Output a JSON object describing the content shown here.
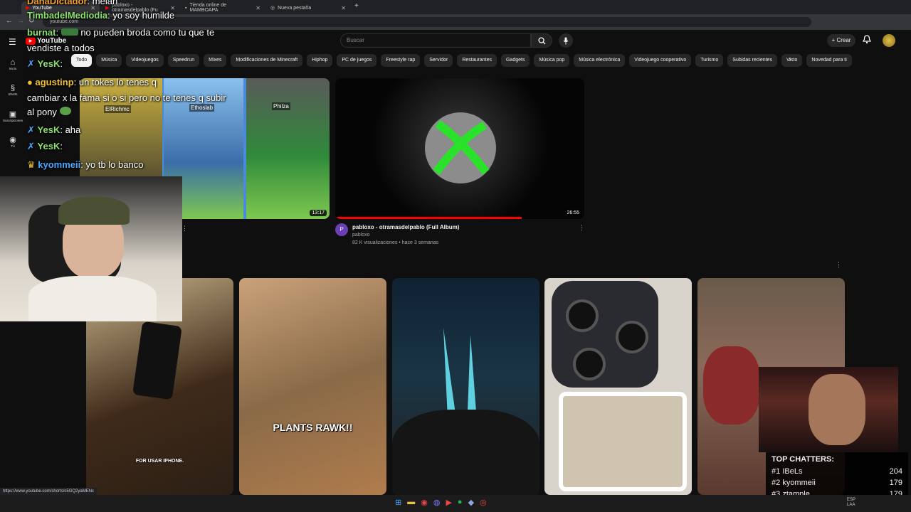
{
  "browser": {
    "tabs": [
      {
        "label": "YouTube",
        "active": true
      },
      {
        "label": "pabloxo - otramasdelpablo (Fu",
        "active": false
      },
      {
        "label": "Tienda online de MAMBOAPA",
        "active": false
      },
      {
        "label": "Nueva pestaña",
        "active": false
      }
    ],
    "url": "youtube.com",
    "status_url": "https://www.youtube.com/shorts/c5GQ2yaMENc"
  },
  "youtube": {
    "logo": "YouTube",
    "search_placeholder": "Buscar",
    "create_label": "Crear",
    "sidebar": [
      {
        "label": "Inicio",
        "icon": "home-icon"
      },
      {
        "label": "Shorts",
        "icon": "shorts-icon"
      },
      {
        "label": "Suscripciones",
        "icon": "subscriptions-icon"
      },
      {
        "label": "Tú",
        "icon": "user-icon"
      }
    ],
    "chips": [
      "Todo",
      "Música",
      "Videojuegos",
      "Speedrun",
      "Mixes",
      "Modificaciones de Minecraft",
      "Hiphop",
      "PC de juegos",
      "Freestyle rap",
      "Servidor",
      "Restaurantes",
      "Gadgets",
      "Música pop",
      "Música electrónica",
      "Videojuego cooperativo",
      "Turismo",
      "Subidas recientes",
      "Visto",
      "Novedad para ti"
    ],
    "videos": [
      {
        "duration": "13:17",
        "names": [
          "ElRichmc",
          "Ethoslab",
          "Philza"
        ]
      },
      {
        "title": "pabloxo - otramasdelpablo (Full Album)",
        "channel": "pabloxo",
        "meta": "82 K visualizaciones • hace 3 semanas",
        "duration": "26:55",
        "channel_initial": "P"
      }
    ],
    "shorts": [
      {
        "caption": "FOR USAR IPHONE."
      },
      {
        "caption": "PLANTS RAWK!!"
      },
      {
        "caption": ""
      },
      {
        "caption": ""
      },
      {
        "caption": ""
      }
    ]
  },
  "chat": [
    {
      "user": "DanaDictador",
      "msg": "meian",
      "color": "#f0a030"
    },
    {
      "user": "TimbadelMediodia",
      "msg": "yo soy humilde",
      "color": "#8be06a"
    },
    {
      "user": "burnat",
      "msg": "no pueden broda como tu que te",
      "color": "#8be06a"
    },
    {
      "user": "",
      "msg": "vendiste a todos",
      "color": "#fff"
    },
    {
      "user": "YesK",
      "msg": "",
      "color": "#8be06a"
    },
    {
      "user": "agustinp",
      "msg": "un tokes lo tenes q",
      "color": "#f0c030"
    },
    {
      "user": "",
      "msg": "cambiar x la fama si o si pero no te tenes q subir",
      "color": "#fff"
    },
    {
      "user": "",
      "msg": "al pony",
      "color": "#fff"
    },
    {
      "user": "YesK",
      "msg": "aha",
      "color": "#8be06a"
    },
    {
      "user": "YesK",
      "msg": "",
      "color": "#8be06a"
    },
    {
      "user": "kyommeii",
      "msg": "yo tb lo banco",
      "color": "#4aa8ff"
    }
  ],
  "top_chatters": {
    "title": "TOP CHATTERS:",
    "rows": [
      {
        "rank": "#1",
        "name": "IBeLs",
        "count": "204"
      },
      {
        "rank": "#2",
        "name": "kyommeii",
        "count": "179"
      },
      {
        "rank": "#3",
        "name": "ztample",
        "count": "179"
      }
    ]
  },
  "taskbar": {
    "lang": "ESP",
    "lang2": "LAA"
  }
}
